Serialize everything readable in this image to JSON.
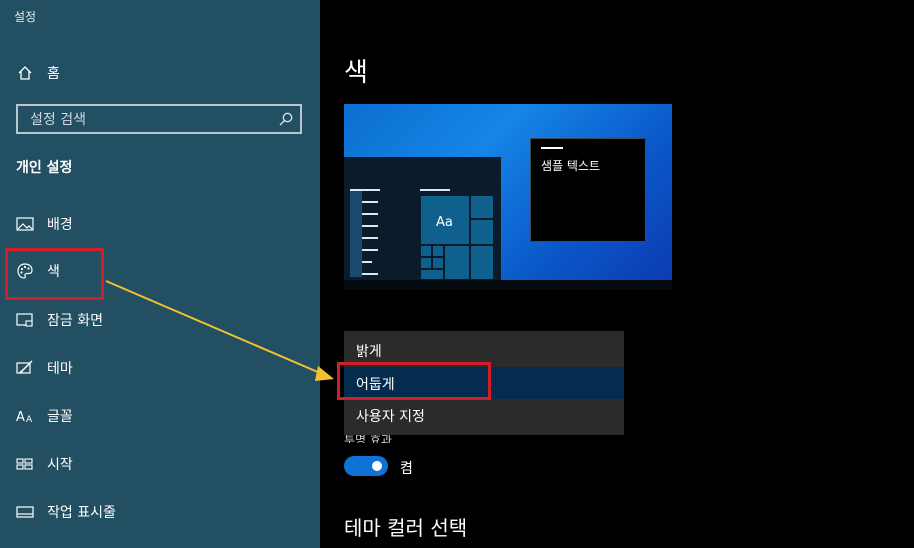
{
  "window": {
    "title": "설정"
  },
  "sidebar": {
    "home": {
      "icon": "home-icon",
      "label": "홈"
    },
    "search": {
      "placeholder": "설정 검색",
      "value": "",
      "icon": "search-icon"
    },
    "section_title": "개인 설정",
    "items": [
      {
        "icon": "image-icon",
        "label": "배경"
      },
      {
        "icon": "palette-icon",
        "label": "색",
        "highlighted": true
      },
      {
        "icon": "lock-screen-icon",
        "label": "잠금 화면"
      },
      {
        "icon": "theme-brush-icon",
        "label": "테마"
      },
      {
        "icon": "font-icon",
        "label": "글꼴"
      },
      {
        "icon": "start-icon",
        "label": "시작"
      },
      {
        "icon": "taskbar-icon",
        "label": "작업 표시줄"
      }
    ]
  },
  "main": {
    "title": "색",
    "preview": {
      "tile_text": "Aa",
      "window_text": "샘플 텍스트"
    },
    "dropdown": {
      "options": [
        "밝게",
        "어둡게",
        "사용자 지정"
      ],
      "selected": "어둡게"
    },
    "hidden_label": "투명 효과",
    "toggle": {
      "label": "켬",
      "state": "on"
    },
    "section_title": "테마 컬러 선택"
  },
  "colors": {
    "sidebar_bg": "#234f63",
    "accent": "#0e72d6",
    "highlight_box": "#d21e2b",
    "arrow": "#f2c12e"
  }
}
